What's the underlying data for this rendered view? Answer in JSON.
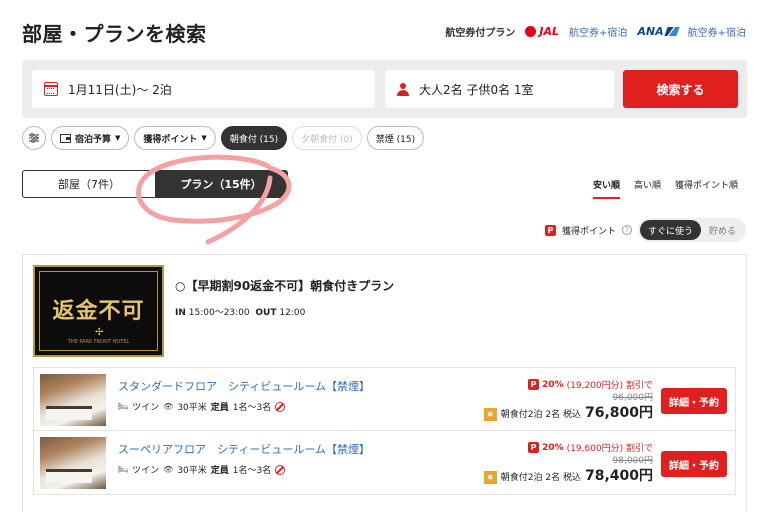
{
  "header": {
    "title": "部屋・プランを検索",
    "air_label": "航空券付プラン",
    "jal": {
      "logo": "JAL",
      "sub": "航空券+宿泊"
    },
    "ana": {
      "logo": "ANA",
      "sub": "航空券+宿泊"
    }
  },
  "search": {
    "date": "1月11日(土)〜 2泊",
    "guests": "大人2名 子供0名 1室",
    "button": "検索する"
  },
  "filters": [
    {
      "label": "宿泊予算",
      "icon": "wallet-icon",
      "dropdown": true
    },
    {
      "label": "獲得ポイント",
      "dropdown": true
    },
    {
      "label": "朝食付 (15)",
      "state": "selected"
    },
    {
      "label": "夕朝食付 (0)",
      "state": "disabled"
    },
    {
      "label": "禁煙 (15)",
      "state": "normal"
    }
  ],
  "tabs": {
    "rooms": "部屋（7件）",
    "plans": "プラン（15件）"
  },
  "sort": {
    "cheap": "安い順",
    "expensive": "高い順",
    "points": "獲得ポイント順"
  },
  "points": {
    "label": "獲得ポイント",
    "use_now": "すぐに使う",
    "save": "貯める"
  },
  "plan": {
    "image_text": "返金不可",
    "image_caption": "THE PARK FRONT HOTEL",
    "title": "【早期割90返金不可】朝食付きプラン",
    "in_label": "IN",
    "in_time": "15:00〜23:00",
    "out_label": "OUT",
    "out_time": "12:00"
  },
  "rooms": [
    {
      "name": "スタンダードフロア　シティビュールーム【禁煙】",
      "bed": "ツイン",
      "size": "30平米",
      "capacity_label": "定員",
      "capacity": "1名〜3名",
      "discount_pct": "20%",
      "discount_text": "(19,200円分) 割引で",
      "original_price": "96,000円",
      "price_note": "朝食付2泊 2名 税込",
      "price": "76,800円",
      "button": "詳細・予約"
    },
    {
      "name": "スーペリアフロア　シティービュールーム【禁煙】",
      "bed": "ツイン",
      "size": "30平米",
      "capacity_label": "定員",
      "capacity": "1名〜3名",
      "discount_pct": "20%",
      "discount_text": "(19,600円分) 割引で",
      "original_price": "98,000円",
      "price_note": "朝食付2泊 2名 税込",
      "price": "78,400円",
      "button": "詳細・予約"
    }
  ],
  "colors": {
    "accent": "#e0201f",
    "link": "#2c6fbf",
    "dark": "#333333"
  }
}
